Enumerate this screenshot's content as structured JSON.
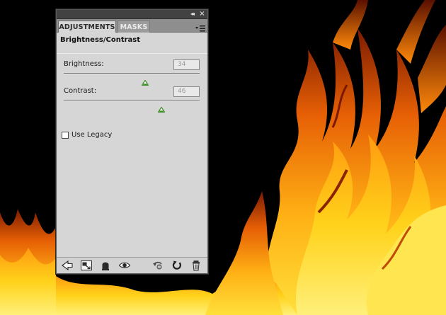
{
  "panel": {
    "tabs": [
      {
        "label": "ADJUSTMENTS",
        "active": true
      },
      {
        "label": "MASKS",
        "active": false
      }
    ],
    "topbar": {
      "collapse_icon": "double-chevron-left-icon",
      "collapse_glyph": "◂◂",
      "close_icon": "close-icon",
      "close_glyph": "×"
    },
    "menu_icon": "panel-menu-icon",
    "title": "Brightness/Contrast",
    "brightness": {
      "label": "Brightness:",
      "value": "34",
      "slider_fraction": 0.6
    },
    "contrast": {
      "label": "Contrast:",
      "value": "46",
      "slider_fraction": 0.72
    },
    "legacy": {
      "label": "Use Legacy",
      "checked": false
    },
    "toolbar": [
      {
        "name": "back-arrow-icon"
      },
      {
        "name": "expanded-view-icon"
      },
      {
        "name": "clip-to-layer-icon"
      },
      {
        "name": "visibility-eye-icon"
      },
      {
        "name": "previous-state-icon"
      },
      {
        "name": "reset-icon"
      },
      {
        "name": "trash-icon"
      }
    ]
  },
  "colors": {
    "panel_bg": "#d6d6d6",
    "tabbar_bg": "#8e8e8e",
    "topbar_bg": "#424242",
    "thumb": "#3f8f2a",
    "fire_yellow": "#ffd21a",
    "fire_orange": "#f07a0a",
    "fire_red": "#b02a00"
  }
}
